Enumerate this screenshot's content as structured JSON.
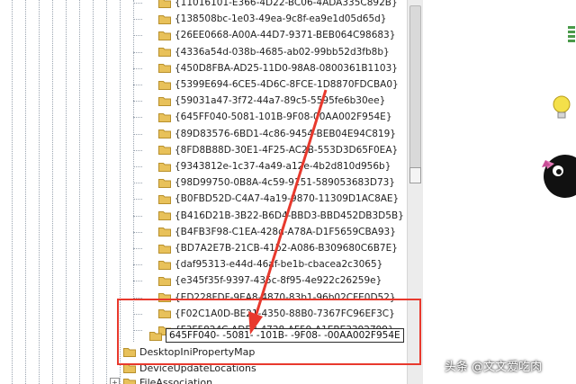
{
  "registry_tree": {
    "guid_keys": [
      "{11016101-E366-4D22-BC06-4ADA335C892B}",
      "{138508bc-1e03-49ea-9c8f-ea9e1d05d65d}",
      "{26EE0668-A00A-44D7-9371-BEB064C98683}",
      "{4336a54d-038b-4685-ab02-99bb52d3fb8b}",
      "{450D8FBA-AD25-11D0-98A8-0800361B1103}",
      "{5399E694-6CE5-4D6C-8FCE-1D8870FDCBA0}",
      "{59031a47-3f72-44a7-89c5-5595fe6b30ee}",
      "{645FF040-5081-101B-9F08-00AA002F954E}",
      "{89D83576-6BD1-4c86-9454-BEB04E94C819}",
      "{8FD8B88D-30E1-4F25-AC2B-553D3D65F0EA}",
      "{9343812e-1c37-4a49-a12e-4b2d810d956b}",
      "{98D99750-0B8A-4c59-9151-589053683D73}",
      "{B0FBD52D-C4A7-4a19-9870-11309D1AC8AE}",
      "{B416D21B-3B22-B6D4-BBD3-BBD452DB3D5B}",
      "{B4FB3F98-C1EA-428d-A78A-D1F5659CBA93}",
      "{BD7A2E7B-21CB-41b2-A086-B309680C6B7E}",
      "{daf95313-e44d-46af-be1b-cbacea2c3065}",
      "{e345f35f-9397-435c-8f95-4e922c26259e}",
      "{ED228FDF-9EA8-4870-83b1-96b02CFE0D52}",
      "{F02C1A0D-BE21-4350-88B0-7367FC96EF3C}",
      "{F3F5824C-AD58-4728-AF59-A1EBE3392799}"
    ],
    "editing_value": "645FF040-  -5081-  -101B-  -9F08-  -00AA002F954E",
    "top_level_keys": [
      "DesktopIniPropertyMap",
      "DeviceUpdateLocations",
      "FileAssociation"
    ]
  },
  "watermark": "头条 @文文爱吃肉",
  "colors": {
    "highlight": "#e8392d",
    "folder": "#e8c15a",
    "tree_line": "#9aa4b0"
  },
  "icons": [
    "folder-icon",
    "expander-icon",
    "arrow-annotation"
  ]
}
